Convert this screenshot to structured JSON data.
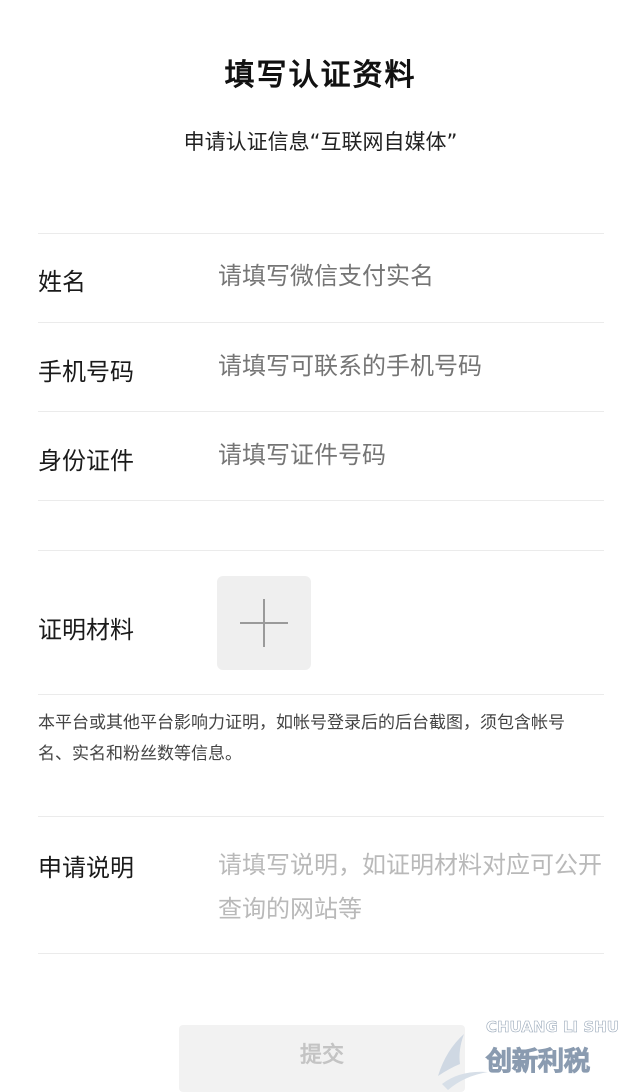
{
  "page": {
    "title": "填写认证资料",
    "subtitle": "申请认证信息“互联网自媒体”"
  },
  "form": {
    "name": {
      "label": "姓名",
      "placeholder": "请填写微信支付实名"
    },
    "phone": {
      "label": "手机号码",
      "placeholder": "请填写可联系的手机号码"
    },
    "id_card": {
      "label": "身份证件",
      "placeholder": "请填写证件号码"
    },
    "proof": {
      "label": "证明材料",
      "upload_icon": "plus-icon",
      "hint": "本平台或其他平台影响力证明，如帐号登录后的后台截图，须包含帐号名、实名和粉丝数等信息。"
    },
    "description": {
      "label": "申请说明",
      "placeholder": "请填写说明，如证明材料对应可公开查询的网站等"
    },
    "submit_label": "提交"
  },
  "watermark": {
    "line1": "CHUANG LI SHU",
    "line2": "创 新 利 税"
  },
  "colors": {
    "placeholder": "#b9b9b9",
    "divider": "#ebebeb",
    "upload_bg": "#efefef",
    "submit_bg": "#f2f2f2",
    "submit_text": "#c4c4c4"
  }
}
